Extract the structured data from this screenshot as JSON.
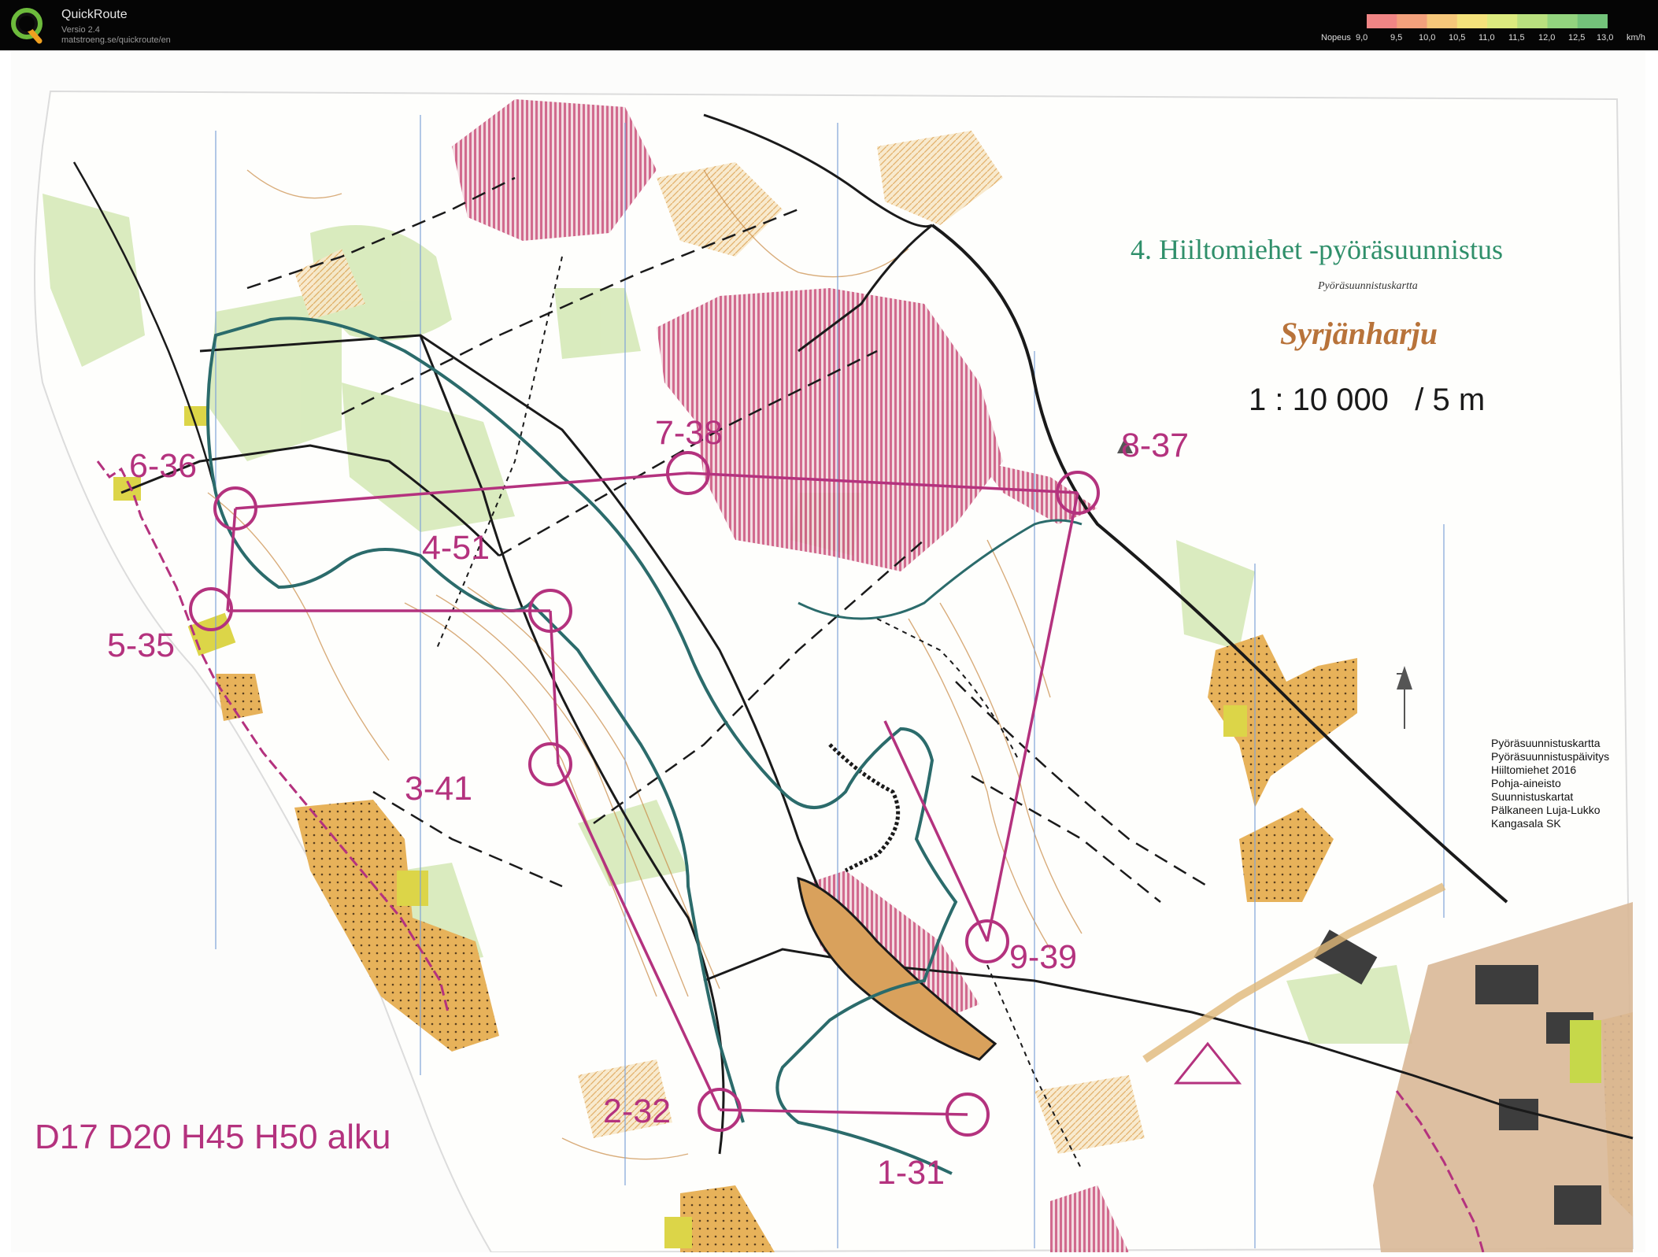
{
  "app": {
    "title": "QuickRoute",
    "version": "Versio 2.4",
    "url": "matstroeng.se/quickroute/en"
  },
  "speed_legend": {
    "label": "Nopeus",
    "ticks": [
      "9,0",
      "9,5",
      "10,0",
      "10,5",
      "11,0",
      "11,5",
      "12,0",
      "12,5",
      "13,0",
      "km/h"
    ],
    "colors": [
      "#f08585",
      "#f3a17c",
      "#f6c77a",
      "#f4e27b",
      "#dcea7e",
      "#b9e07e",
      "#93d47e",
      "#73c37a"
    ]
  },
  "map": {
    "title": "4. Hiiltomiehet -pyöräsuunnistus",
    "subtitle": "Pyöräsuunnistuskartta",
    "area": "Syrjänharju",
    "scale": "1 : 10 000   / 5 m",
    "class_text": "D17 D20 H45 H50 alku",
    "credits": [
      "Pyöräsuunnistuskartta",
      "Pyöräsuunnistuspäivitys",
      "Hiiltomiehet 2016",
      "Pohja-aineisto",
      "Suunnistuskartat",
      "Pälkaneen Luja-Lukko",
      "Kangasala SK"
    ],
    "controls": [
      "1-31",
      "2-32",
      "3-41",
      "4-51",
      "5-35",
      "6-36",
      "7-38",
      "8-37",
      "9-39"
    ],
    "colors": {
      "course": "#b4327e",
      "route": "#2b6b6b",
      "title": "#2f8f6a",
      "area": "#b8733a",
      "open_land": "#e3b35b",
      "vegetation": "#c9e2a6",
      "marsh": "#c9507a"
    }
  }
}
